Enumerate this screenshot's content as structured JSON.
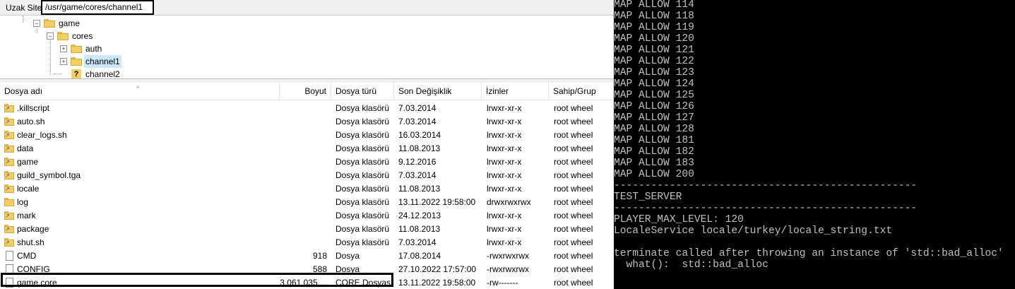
{
  "site_bar": {
    "label": "Uzak Site:",
    "path": "/usr/game/cores/channel1"
  },
  "tree": {
    "nodes": [
      {
        "label": "game",
        "expander": "−"
      },
      {
        "label": "cores",
        "expander": "−"
      },
      {
        "label": "auth",
        "expander": "+"
      },
      {
        "label": "channel1",
        "expander": "+"
      },
      {
        "label": "channel2",
        "icon": "?"
      }
    ]
  },
  "columns": {
    "name": "Dosya adı",
    "size": "Boyut",
    "type": "Dosya türü",
    "modified": "Son Değişiklik",
    "perms": "İzinler",
    "owner": "Sahip/Grup"
  },
  "files": [
    {
      "name": ".killscript",
      "icon": "link-folder-icon",
      "size": "",
      "type": "Dosya klasörü",
      "modified": "7.03.2014",
      "perms": "lrwxr-xr-x",
      "owner": "root wheel"
    },
    {
      "name": "auto.sh",
      "icon": "link-folder-icon",
      "size": "",
      "type": "Dosya klasörü",
      "modified": "7.03.2014",
      "perms": "lrwxr-xr-x",
      "owner": "root wheel"
    },
    {
      "name": "clear_logs.sh",
      "icon": "link-folder-icon",
      "size": "",
      "type": "Dosya klasörü",
      "modified": "16.03.2014",
      "perms": "lrwxr-xr-x",
      "owner": "root wheel"
    },
    {
      "name": "data",
      "icon": "link-folder-icon",
      "size": "",
      "type": "Dosya klasörü",
      "modified": "11.08.2013",
      "perms": "lrwxr-xr-x",
      "owner": "root wheel"
    },
    {
      "name": "game",
      "icon": "link-folder-icon",
      "size": "",
      "type": "Dosya klasörü",
      "modified": "9.12.2016",
      "perms": "lrwxr-xr-x",
      "owner": "root wheel"
    },
    {
      "name": "guild_symbol.tga",
      "icon": "link-folder-icon",
      "size": "",
      "type": "Dosya klasörü",
      "modified": "7.03.2014",
      "perms": "lrwxr-xr-x",
      "owner": "root wheel"
    },
    {
      "name": "locale",
      "icon": "link-folder-icon",
      "size": "",
      "type": "Dosya klasörü",
      "modified": "11.08.2013",
      "perms": "lrwxr-xr-x",
      "owner": "root wheel"
    },
    {
      "name": "log",
      "icon": "folder-icon",
      "size": "",
      "type": "Dosya klasörü",
      "modified": "13.11.2022 19:58:00",
      "perms": "drwxrwxrwx",
      "owner": "root wheel"
    },
    {
      "name": "mark",
      "icon": "link-folder-icon",
      "size": "",
      "type": "Dosya klasörü",
      "modified": "24.12.2013",
      "perms": "lrwxr-xr-x",
      "owner": "root wheel"
    },
    {
      "name": "package",
      "icon": "link-folder-icon",
      "size": "",
      "type": "Dosya klasörü",
      "modified": "11.08.2013",
      "perms": "lrwxr-xr-x",
      "owner": "root wheel"
    },
    {
      "name": "shut.sh",
      "icon": "link-folder-icon",
      "size": "",
      "type": "Dosya klasörü",
      "modified": "7.03.2014",
      "perms": "lrwxr-xr-x",
      "owner": "root wheel"
    },
    {
      "name": "CMD",
      "icon": "file-icon",
      "size": "918",
      "type": "Dosya",
      "modified": "17.08.2014",
      "perms": "-rwxrwxrwx",
      "owner": "root wheel"
    },
    {
      "name": "CONFIG",
      "icon": "file-icon",
      "size": "588",
      "type": "Dosya",
      "modified": "27.10.2022 17:57:00",
      "perms": "-rwxrwxrwx",
      "owner": "root wheel"
    },
    {
      "name": "game.core",
      "icon": "file-icon",
      "size": "3.061.035....",
      "type": "CORE Dosyası",
      "modified": "13.11.2022 19:58:00",
      "perms": "-rw-------",
      "owner": "root wheel"
    }
  ],
  "terminal": {
    "lines": [
      "MAP ALLOW 114",
      "MAP ALLOW 118",
      "MAP ALLOW 119",
      "MAP ALLOW 120",
      "MAP ALLOW 121",
      "MAP ALLOW 122",
      "MAP ALLOW 123",
      "MAP ALLOW 124",
      "MAP ALLOW 125",
      "MAP ALLOW 126",
      "MAP ALLOW 127",
      "MAP ALLOW 128",
      "MAP ALLOW 181",
      "MAP ALLOW 182",
      "MAP ALLOW 183",
      "MAP ALLOW 200",
      "-------------------------------------------------",
      "TEST_SERVER",
      "-------------------------------------------------",
      "PLAYER_MAX_LEVEL: 120",
      "LocaleService locale/turkey/locale_string.txt",
      "",
      "terminate called after throwing an instance of 'std::bad_alloc'",
      "  what():  std::bad_alloc"
    ]
  }
}
